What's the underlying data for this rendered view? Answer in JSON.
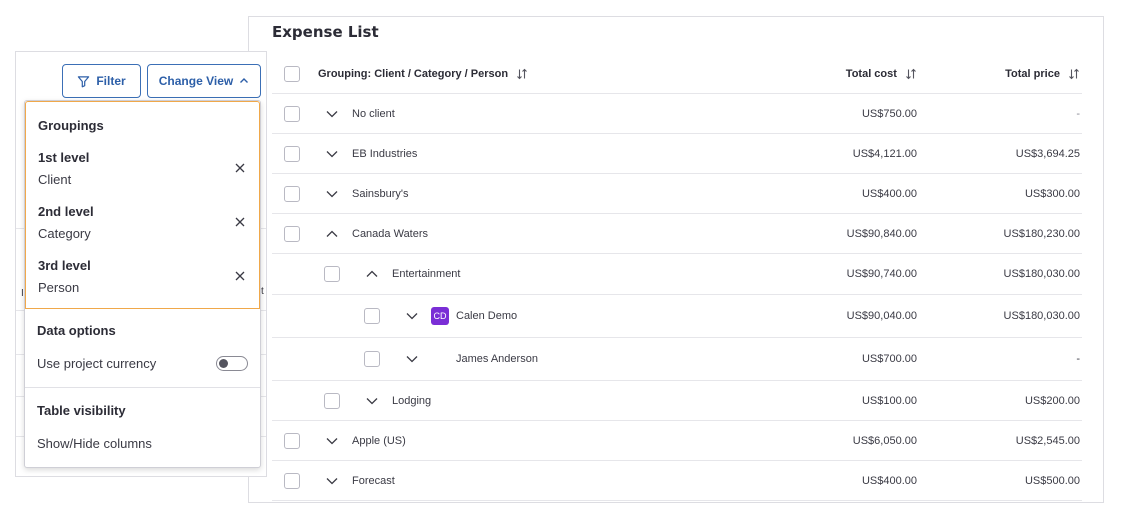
{
  "expense_list": {
    "title": "Expense List",
    "columns": {
      "grouping": "Grouping: Client / Category / Person",
      "total_cost": "Total cost",
      "total_price": "Total price"
    },
    "rows": [
      {
        "label": "No client",
        "cost": "US$750.00",
        "price": "-",
        "level": 0,
        "expanded": false
      },
      {
        "label": "EB Industries",
        "cost": "US$4,121.00",
        "price": "US$3,694.25",
        "level": 0,
        "expanded": false
      },
      {
        "label": "Sainsbury's",
        "cost": "US$400.00",
        "price": "US$300.00",
        "level": 0,
        "expanded": false
      },
      {
        "label": "Canada Waters",
        "cost": "US$90,840.00",
        "price": "US$180,230.00",
        "level": 0,
        "expanded": true
      },
      {
        "label": "Entertainment",
        "cost": "US$90,740.00",
        "price": "US$180,030.00",
        "level": 1,
        "expanded": true
      },
      {
        "label": "Calen Demo",
        "cost": "US$90,040.00",
        "price": "US$180,030.00",
        "level": 2,
        "expanded": false,
        "avatar": "CD"
      },
      {
        "label": "James Anderson",
        "cost": "US$700.00",
        "price": "-",
        "level": 2,
        "expanded": false
      },
      {
        "label": "Lodging",
        "cost": "US$100.00",
        "price": "US$200.00",
        "level": 1,
        "expanded": false
      },
      {
        "label": "Apple (US)",
        "cost": "US$6,050.00",
        "price": "US$2,545.00",
        "level": 0,
        "expanded": false
      },
      {
        "label": "Forecast",
        "cost": "US$400.00",
        "price": "US$500.00",
        "level": 0,
        "expanded": false
      }
    ]
  },
  "toolbar": {
    "filter_label": "Filter",
    "change_view_label": "Change View"
  },
  "view_menu": {
    "groupings_title": "Groupings",
    "levels": [
      {
        "title": "1st level",
        "value": "Client"
      },
      {
        "title": "2nd level",
        "value": "Category"
      },
      {
        "title": "3rd level",
        "value": "Person"
      }
    ],
    "data_options_title": "Data options",
    "use_project_currency_label": "Use project currency",
    "use_project_currency_on": false,
    "table_visibility_title": "Table visibility",
    "show_hide_columns_label": "Show/Hide columns"
  },
  "background_fragments": {
    "left_letter": "I",
    "right_letter": "t"
  },
  "colors": {
    "accent_blue": "#2d5fa8",
    "highlight_orange": "#f0a84a",
    "avatar_purple": "#7a2ed6"
  }
}
